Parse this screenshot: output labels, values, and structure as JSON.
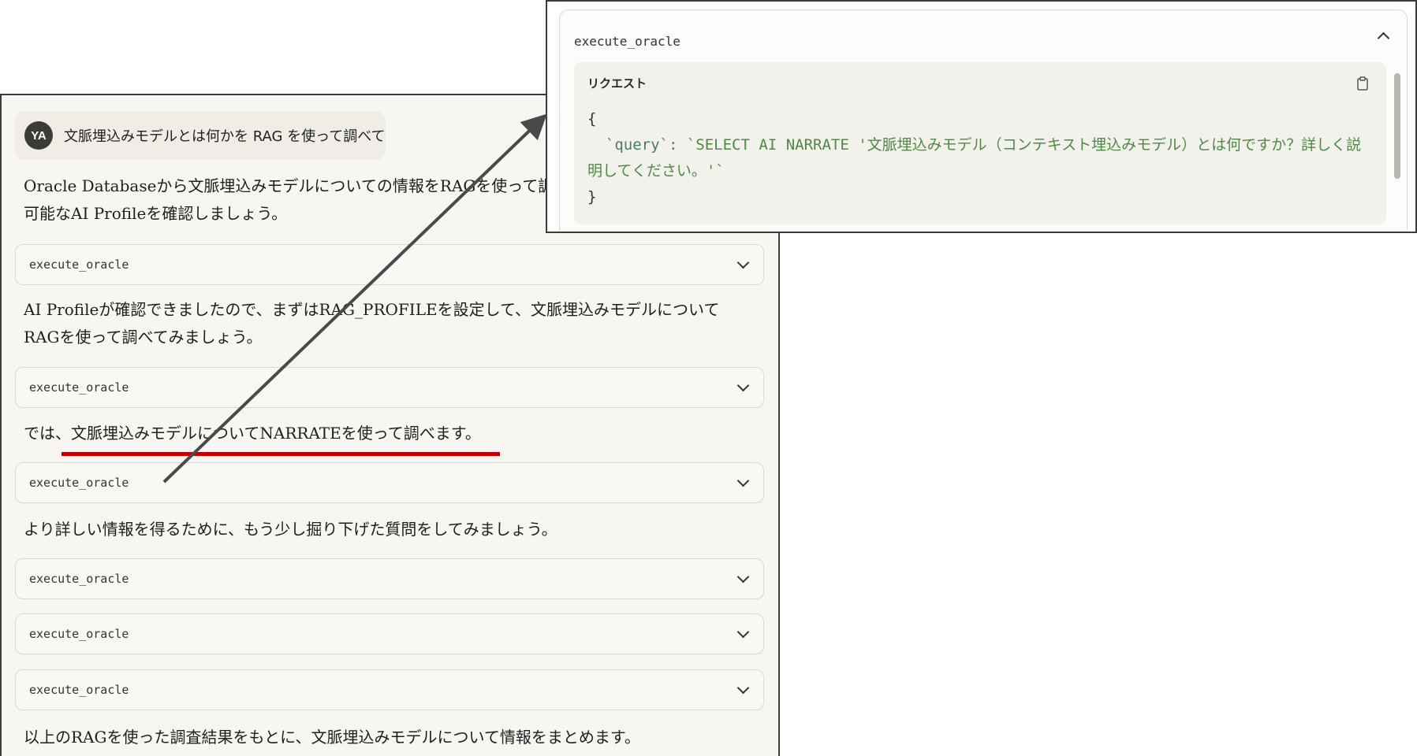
{
  "user": {
    "avatar_initials": "YA",
    "message": "文脈埋込みモデルとは何かを RAG を使って調べて"
  },
  "messages": {
    "m1_line1": "Oracle Databaseから文脈埋込みモデルについての情報をRAGを使って調",
    "m1_line2": "可能なAI Profileを確認しましょう。",
    "m2_line1": "AI Profileが確認できましたので、まずはRAG_PROFILEを設定して、文脈埋込みモデルについて",
    "m2_line2": "RAGを使って調べてみましょう。",
    "m3": "では、文脈埋込みモデルについてNARRATEを使って調べます。",
    "m4": "より詳しい情報を得るために、もう少し掘り下げた質問をしてみましょう。",
    "m5": "以上のRAGを使った調査結果をもとに、文脈埋込みモデルについて情報をまとめます。"
  },
  "tool_calls": [
    {
      "name": "execute_oracle"
    },
    {
      "name": "execute_oracle"
    },
    {
      "name": "execute_oracle"
    },
    {
      "name": "execute_oracle"
    },
    {
      "name": "execute_oracle"
    },
    {
      "name": "execute_oracle"
    }
  ],
  "callout": {
    "title": "execute_oracle",
    "request_label": "リクエスト",
    "code_open": "{",
    "code_key": "`query`",
    "code_colon": ": ",
    "code_value": "`SELECT AI NARRATE '文脈埋込みモデル（コンテキスト埋込みモデル）とは何ですか？詳しく説明してください。'`",
    "code_close": "}"
  },
  "icons": {
    "chevron": "chevron-down-icon",
    "copy": "clipboard-icon"
  },
  "colors": {
    "underline": "#c00000",
    "code_string": "#4f8a45",
    "arrow": "#4a4a4a"
  }
}
